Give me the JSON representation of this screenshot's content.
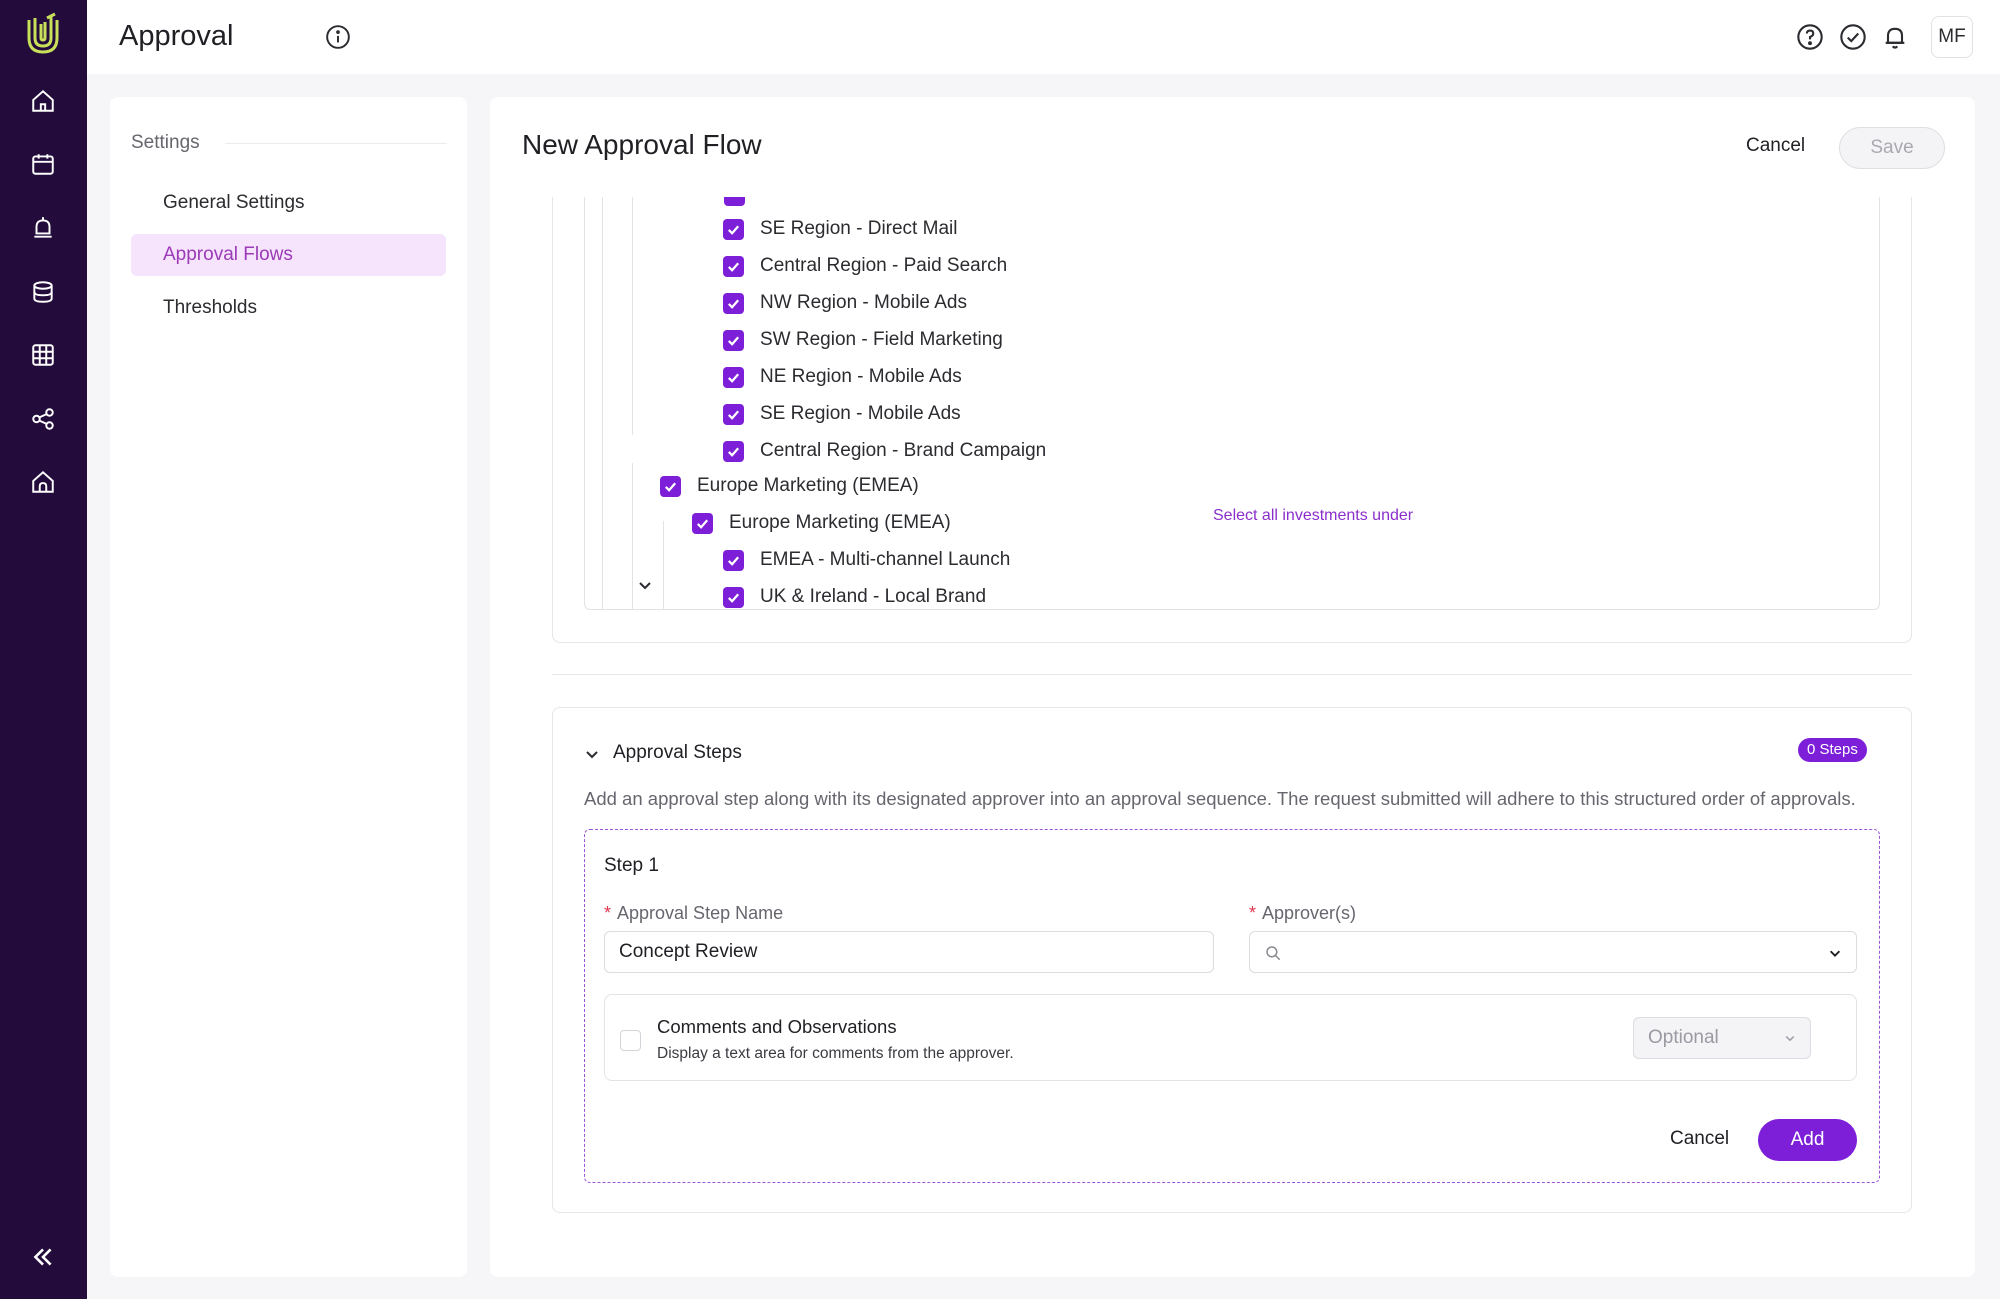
{
  "brand": {
    "accent": "#7d1fd8",
    "rail_bg": "#230b3c",
    "logo_color": "#c8e05a"
  },
  "rail": {
    "items": [
      {
        "icon": "home-icon"
      },
      {
        "icon": "calendar-icon"
      },
      {
        "icon": "bell-icon"
      },
      {
        "icon": "layers-icon"
      },
      {
        "icon": "table-icon"
      },
      {
        "icon": "share-icon"
      },
      {
        "icon": "home-outline-icon"
      }
    ],
    "collapse_icon": "double-chevron-left-icon"
  },
  "topbar": {
    "title": "Approval",
    "avatar": "MF",
    "icons": [
      "help-icon",
      "check-circle-icon",
      "notification-icon"
    ]
  },
  "settings": {
    "heading": "Settings",
    "items": [
      {
        "label": "General Settings",
        "active": false
      },
      {
        "label": "Approval Flows",
        "active": true
      },
      {
        "label": "Thresholds",
        "active": false
      }
    ]
  },
  "main": {
    "title": "New Approval Flow",
    "cancel_label": "Cancel",
    "save_label": "Save"
  },
  "investments": {
    "select_all_label": "Select all investments under",
    "rows": [
      {
        "label": "SE Region - Direct Mail",
        "checked": true
      },
      {
        "label": "Central Region - Paid Search",
        "checked": true
      },
      {
        "label": "NW Region - Mobile Ads",
        "checked": true
      },
      {
        "label": "SW Region - Field Marketing",
        "checked": true
      },
      {
        "label": "NE Region - Mobile Ads",
        "checked": true
      },
      {
        "label": "SE Region - Mobile Ads",
        "checked": true
      },
      {
        "label": "Central Region - Brand Campaign",
        "checked": true
      },
      {
        "label": "Europe Marketing (EMEA)",
        "checked": true,
        "expanded": true
      },
      {
        "label": "Europe Marketing (EMEA)",
        "checked": true,
        "expanded": true
      },
      {
        "label": "EMEA - Multi-channel Launch",
        "checked": true,
        "expanded": true
      },
      {
        "label": "UK & Ireland - Local Brand",
        "checked": true
      }
    ]
  },
  "steps": {
    "heading": "Approval Steps",
    "count_badge": "0 Steps",
    "description": "Add an approval step along with its designated approver into an approval sequence. The request submitted will adhere to this structured order of approvals.",
    "step": {
      "title": "Step 1",
      "name_label": "Approval Step Name",
      "name_value": "Concept Review",
      "approver_label": "Approver(s)",
      "approver_value": "",
      "required_mark": "*",
      "comments_title": "Comments and Observations",
      "comments_sub": "Display a text area for comments from the approver.",
      "comments_checked": false,
      "comments_mode": "Optional",
      "cancel_label": "Cancel",
      "add_label": "Add"
    }
  }
}
